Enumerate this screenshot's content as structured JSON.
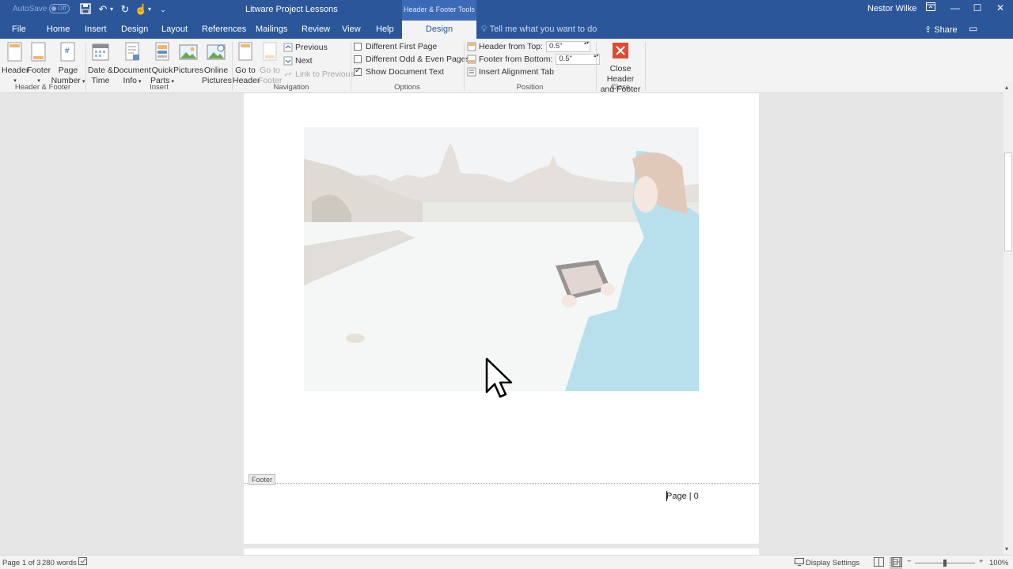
{
  "titlebar": {
    "autosave_label": "AutoSave",
    "autosave_state": "Off",
    "document_title": "Litware Project Lessons",
    "context_tab_group": "Header & Footer Tools",
    "user_name": "Nestor Wilke",
    "accent_color": "#2b579a"
  },
  "tabs": [
    "File",
    "Home",
    "Insert",
    "Design",
    "Layout",
    "References",
    "Mailings",
    "Review",
    "View",
    "Help",
    "Design"
  ],
  "tellme_placeholder": "Tell me what you want to do",
  "share_label": "Share",
  "ribbon": {
    "header_footer_group": {
      "header_label": "Header",
      "footer_label": "Footer",
      "page_number_label_1": "Page",
      "page_number_label_2": "Number",
      "group_label": "Header & Footer"
    },
    "insert_group": {
      "date_time_1": "Date &",
      "date_time_2": "Time",
      "doc_info_1": "Document",
      "doc_info_2": "Info",
      "quick_parts_1": "Quick",
      "quick_parts_2": "Parts",
      "pictures": "Pictures",
      "online_pictures_1": "Online",
      "online_pictures_2": "Pictures",
      "group_label": "Insert"
    },
    "navigation_group": {
      "go_to_header_1": "Go to",
      "go_to_header_2": "Header",
      "go_to_footer_1": "Go to",
      "go_to_footer_2": "Footer",
      "previous": "Previous",
      "next": "Next",
      "link_to_previous": "Link to Previous",
      "group_label": "Navigation"
    },
    "options_group": {
      "different_first_page": "Different First Page",
      "different_odd_even": "Different Odd & Even Pages",
      "show_document_text": "Show Document Text",
      "different_first_page_checked": false,
      "different_odd_even_checked": false,
      "show_document_text_checked": true,
      "group_label": "Options"
    },
    "position_group": {
      "header_from_top_label": "Header from Top:",
      "header_from_top_value": "0.5\"",
      "footer_from_bottom_label": "Footer from Bottom:",
      "footer_from_bottom_value": "0.5\"",
      "insert_alignment_tab": "Insert Alignment Tab",
      "group_label": "Position"
    },
    "close_group": {
      "close_label_1": "Close Header",
      "close_label_2": "and Footer",
      "group_label": "Close",
      "close_color": "#e04a2f"
    }
  },
  "document": {
    "footer_tag": "Footer",
    "footer_text": "Page | 0"
  },
  "statusbar": {
    "page_info": "Page 1 of 3",
    "word_count": "280 words",
    "display_settings": "Display Settings",
    "zoom_level": "100%"
  }
}
